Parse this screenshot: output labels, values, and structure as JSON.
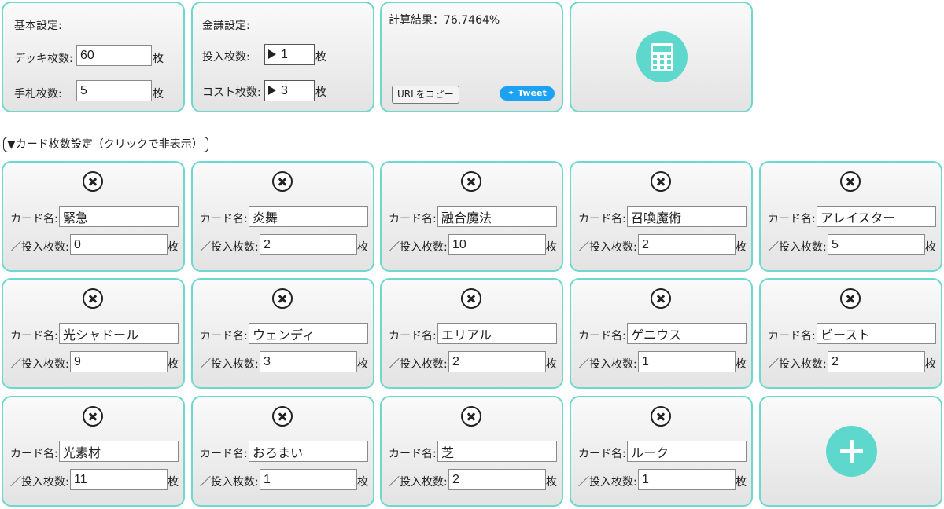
{
  "basic": {
    "title": "基本設定:",
    "deck_label": "デッキ枚数:",
    "deck_value": "60",
    "hand_label": "手札枚数:",
    "hand_value": "5",
    "unit": "枚"
  },
  "pot": {
    "title": "金謙設定:",
    "invest_label": "投入枚数:",
    "invest_value": "1",
    "cost_label": "コスト枚数:",
    "cost_value": "3",
    "unit": "枚"
  },
  "result": {
    "label": "計算結果：76.7464%",
    "copy_button": "URLをコピー",
    "tweet_button": "Tweet"
  },
  "toggle_label": "▼カード枚数設定（クリックで非表示）",
  "card_labels": {
    "name": "カード名:",
    "count": "／投入枚数:",
    "unit": "枚"
  },
  "cards": [
    {
      "name": "緊急",
      "count": "0"
    },
    {
      "name": "炎舞",
      "count": "2"
    },
    {
      "name": "融合魔法",
      "count": "10"
    },
    {
      "name": "召喚魔術",
      "count": "2"
    },
    {
      "name": "アレイスター",
      "count": "5"
    },
    {
      "name": "光シャドール",
      "count": "9"
    },
    {
      "name": "ウェンディ",
      "count": "3"
    },
    {
      "name": "エリアル",
      "count": "2"
    },
    {
      "name": "ゲニウス",
      "count": "1"
    },
    {
      "name": "ビースト",
      "count": "2"
    },
    {
      "name": "光素材",
      "count": "11"
    },
    {
      "name": "おろまい",
      "count": "1"
    },
    {
      "name": "芝",
      "count": "2"
    },
    {
      "name": "ルーク",
      "count": "1"
    }
  ],
  "colors": {
    "accent": "#5ed8cd",
    "border": "#6ed8cf",
    "tweet": "#1da1f2"
  }
}
